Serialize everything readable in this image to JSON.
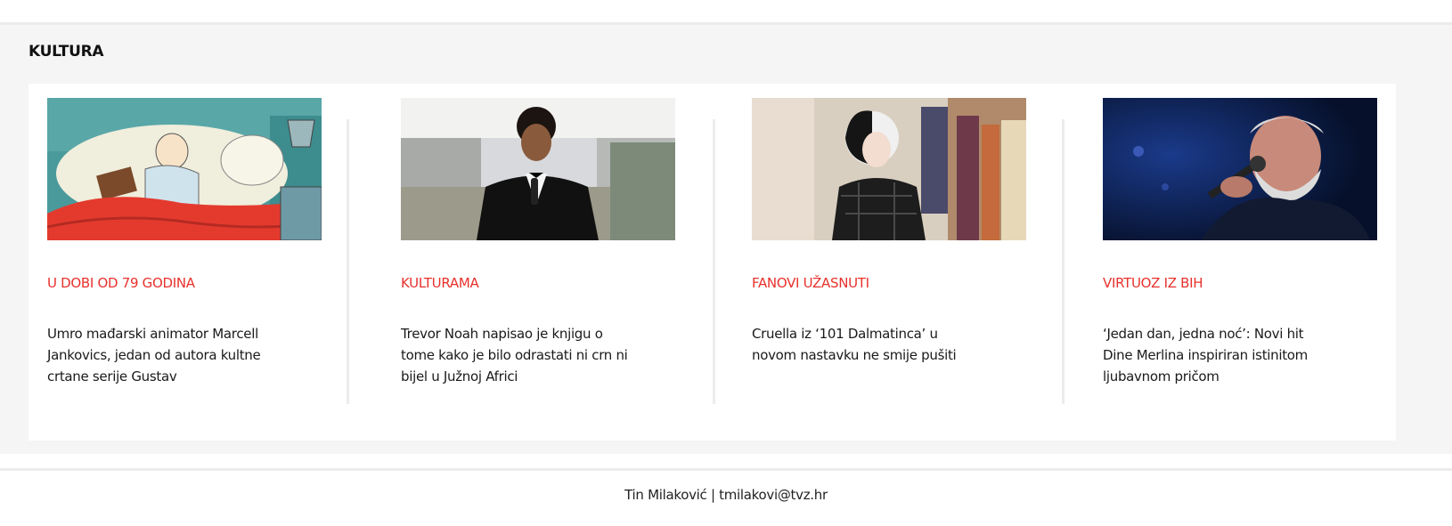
{
  "section": {
    "title": "KULTURA"
  },
  "articles": [
    {
      "kicker": "U DOBI OD 79 GODINA",
      "title": "Umro mađarski animator Marcell Jankovics, jedan od autora kultne crtane serije Gustav",
      "image": "cartoon-man-reading-in-bed"
    },
    {
      "kicker": "KULTURAMA",
      "title": "Trevor Noah napisao je knjigu o tome kako je bilo odrastati ni crn ni bijel u Južnoj Africi",
      "image": "host-in-tuxedo-with-microphone"
    },
    {
      "kicker": "FANOVI UŽASNUTI",
      "title": "Cruella iz ‘101 Dalmatinca’ u novom nastavku ne smije pušiti",
      "image": "woman-black-white-hair-in-shop"
    },
    {
      "kicker": "VIRTUOZ IZ BIH",
      "title": "‘Jedan dan, jedna noć’: Novi hit Dine Merlina inspiriran istinitom ljubavnom pričom",
      "image": "singer-on-stage-with-microphone"
    }
  ],
  "footer": {
    "text": "Tin Milaković | tmilakovi@tvz.hr"
  },
  "colors": {
    "accent": "#e8312c",
    "section_background": "#f5f5f5",
    "panel_background": "#ffffff",
    "divider": "#ececec"
  }
}
